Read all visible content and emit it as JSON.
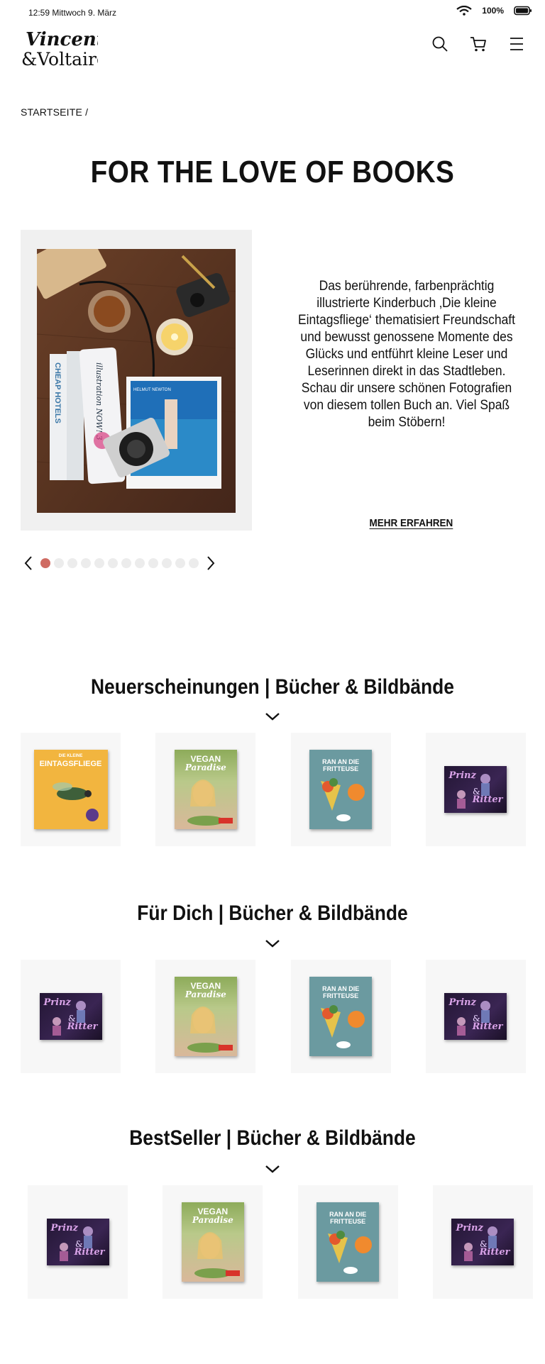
{
  "status": {
    "time": "12:59 Mittwoch 9. März",
    "battery": "100%"
  },
  "header": {
    "logo_line1": "Vincent",
    "logo_line2": "&Voltaire"
  },
  "breadcrumb": "STARTSEITE /",
  "hero": {
    "title": "FOR THE LOVE OF BOOKS",
    "text": "Das berührende, farbenprächtig illustrierte Kinderbuch ‚Die kleine Eintagsfliege‘ thematisiert Freundschaft und bewusst genossene Momente des Glücks und entführt kleine Leser und Leserinnen direkt in das Stadtleben. Schau dir unsere schönen Fotografien von diesem tollen Buch an. Viel Spaß beim Stöbern!",
    "more_label": "MEHR ERFAHREN",
    "photo_books": [
      "CHEAP HOTELS",
      "illustration NOW! 3",
      "HELMUT NEWTON"
    ],
    "slide_count": 12,
    "active_slide": 1
  },
  "sections": [
    {
      "title": "Neuerscheinungen | Bücher & Bildbände",
      "books": [
        {
          "cover": "eintagsfliege",
          "line1": "DIE KLEINE",
          "line2": "EINTAGSFLIEGE"
        },
        {
          "cover": "vegan",
          "line1": "VEGAN",
          "line2": "Paradise"
        },
        {
          "cover": "fritteuse",
          "line1": "RAN AN DIE",
          "line2": "FRITTEUSE"
        },
        {
          "cover": "prinz",
          "line1": "Prinz",
          "line2": "Ritter"
        }
      ]
    },
    {
      "title": "Für Dich | Bücher & Bildbände",
      "books": [
        {
          "cover": "prinz",
          "line1": "Prinz",
          "line2": "Ritter"
        },
        {
          "cover": "vegan",
          "line1": "VEGAN",
          "line2": "Paradise"
        },
        {
          "cover": "fritteuse",
          "line1": "RAN AN DIE",
          "line2": "FRITTEUSE"
        },
        {
          "cover": "prinz",
          "line1": "Prinz",
          "line2": "Ritter"
        }
      ]
    },
    {
      "title": "BestSeller | Bücher & Bildbände",
      "books": [
        {
          "cover": "prinz",
          "line1": "Prinz",
          "line2": "Ritter"
        },
        {
          "cover": "vegan",
          "line1": "VEGAN",
          "line2": "Paradise"
        },
        {
          "cover": "fritteuse",
          "line1": "RAN AN DIE",
          "line2": "FRITTEUSE"
        },
        {
          "cover": "prinz",
          "line1": "Prinz",
          "line2": "Ritter"
        }
      ]
    }
  ],
  "colors": {
    "accent_dot": "#cf6b62",
    "dot_inactive": "#ececec",
    "card_bg": "#f7f7f7"
  }
}
